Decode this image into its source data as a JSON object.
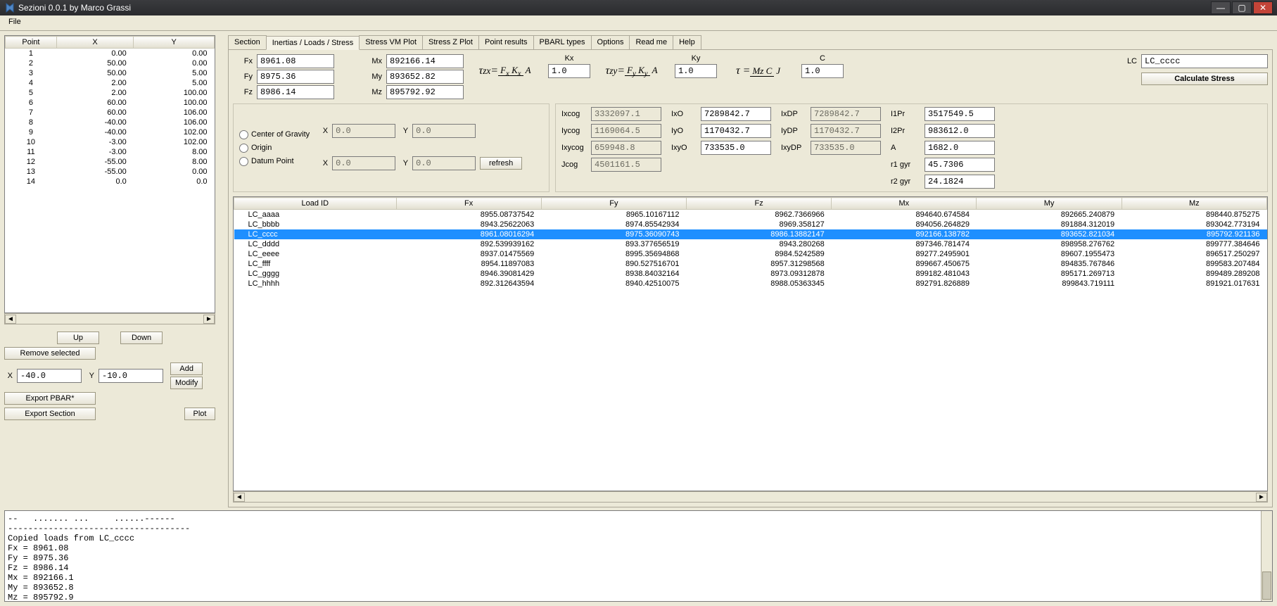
{
  "title": "Sezioni 0.0.1 by Marco Grassi",
  "menubar": {
    "file": "File"
  },
  "points": {
    "headers": [
      "Point",
      "X",
      "Y"
    ],
    "rows": [
      [
        "1",
        "0.00",
        "0.00"
      ],
      [
        "2",
        "50.00",
        "0.00"
      ],
      [
        "3",
        "50.00",
        "5.00"
      ],
      [
        "4",
        "2.00",
        "5.00"
      ],
      [
        "5",
        "2.00",
        "100.00"
      ],
      [
        "6",
        "60.00",
        "100.00"
      ],
      [
        "7",
        "60.00",
        "106.00"
      ],
      [
        "8",
        "-40.00",
        "106.00"
      ],
      [
        "9",
        "-40.00",
        "102.00"
      ],
      [
        "10",
        "-3.00",
        "102.00"
      ],
      [
        "11",
        "-3.00",
        "8.00"
      ],
      [
        "12",
        "-55.00",
        "8.00"
      ],
      [
        "13",
        "-55.00",
        "0.00"
      ],
      [
        "14",
        "0.0",
        "0.0"
      ]
    ]
  },
  "left_buttons": {
    "up": "Up",
    "down": "Down",
    "remove": "Remove selected",
    "add": "Add",
    "modify": "Modify",
    "export_pbar": "Export PBAR*",
    "export_section": "Export Section",
    "plot": "Plot",
    "x_label": "X",
    "x_val": "-40.0",
    "y_label": "Y",
    "y_val": "-10.0"
  },
  "tabs": [
    "Section",
    "Inertias / Loads / Stress",
    "Stress VM Plot",
    "Stress Z Plot",
    "Point results",
    "PBARL types",
    "Options",
    "Read me",
    "Help"
  ],
  "active_tab": 1,
  "forces": {
    "fx_label": "Fx",
    "fx": "8961.08",
    "fy_label": "Fy",
    "fy": "8975.36",
    "fz_label": "Fz",
    "fz": "8986.14",
    "mx_label": "Mx",
    "mx": "892166.14",
    "my_label": "My",
    "my": "893652.82",
    "mz_label": "Mz",
    "mz": "895792.92"
  },
  "kc": {
    "kx_label": "Kx",
    "kx": "1.0",
    "ky_label": "Ky",
    "ky": "1.0",
    "c_label": "C",
    "c": "1.0"
  },
  "lc": {
    "label": "LC",
    "value": "LC_cccc",
    "calc": "Calculate Stress"
  },
  "origin": {
    "cg": "Center of Gravity",
    "origin": "Origin",
    "dp": "Datum Point",
    "x1_label": "X",
    "x1": "0.0",
    "y1_label": "Y",
    "y1": "0.0",
    "x2_label": "X",
    "x2": "0.0",
    "y2_label": "Y",
    "y2": "0.0",
    "refresh": "refresh"
  },
  "cog": {
    "ixcog_label": "Ixcog",
    "ixcog": "3332097.1",
    "iycog_label": "Iycog",
    "iycog": "1169064.5",
    "ixycog_label": "Ixycog",
    "ixycog": "659948.8",
    "jcog_label": "Jcog",
    "jcog": "4501161.5"
  },
  "io": {
    "ixo_label": "IxO",
    "ixo": "7289842.7",
    "iyo_label": "IyO",
    "iyo": "1170432.7",
    "ixyo_label": "IxyO",
    "ixyo": "733535.0"
  },
  "idp": {
    "ixdp_label": "IxDP",
    "ixdp": "7289842.7",
    "iydp_label": "IyDP",
    "iydp": "1170432.7",
    "ixydp_label": "IxyDP",
    "ixydp": "733535.0"
  },
  "props": {
    "i1pr_label": "I1Pr",
    "i1pr": "3517549.5",
    "i2pr_label": "I2Pr",
    "i2pr": "983612.0",
    "a_label": "A",
    "a": "1682.0",
    "r1_label": "r1 gyr",
    "r1": "45.7306",
    "r2_label": "r2 gyr",
    "r2": "24.1824"
  },
  "loads": {
    "headers": [
      "Load ID",
      "Fx",
      "Fy",
      "Fz",
      "Mx",
      "My",
      "Mz"
    ],
    "rows": [
      {
        "sel": false,
        "c": [
          "LC_aaaa",
          "8955.08737542",
          "8965.10167112",
          "8962.7366966",
          "894640.674584",
          "892665.240879",
          "898440.875275"
        ]
      },
      {
        "sel": false,
        "c": [
          "LC_bbbb",
          "8943.25622063",
          "8974.85542934",
          "8969.358127",
          "894056.264829",
          "891884.312019",
          "893042.773194"
        ]
      },
      {
        "sel": true,
        "c": [
          "LC_cccc",
          "8961.08016294",
          "8975.36090743",
          "8986.13882147",
          "892166.138782",
          "893652.821034",
          "895792.921136"
        ]
      },
      {
        "sel": false,
        "c": [
          "LC_dddd",
          "892.539939162",
          "893.377656519",
          "8943.280268",
          "897346.781474",
          "898958.276762",
          "899777.384646"
        ]
      },
      {
        "sel": false,
        "c": [
          "LC_eeee",
          "8937.01475569",
          "8995.35694868",
          "8984.5242589",
          "89277.2495901",
          "89607.1955473",
          "896517.250297"
        ]
      },
      {
        "sel": false,
        "c": [
          "LC_ffff",
          "8954.11897083",
          "890.527516701",
          "8957.31298568",
          "899667.450675",
          "894835.767846",
          "899583.207484"
        ]
      },
      {
        "sel": false,
        "c": [
          "LC_gggg",
          "8946.39081429",
          "8938.84032164",
          "8973.09312878",
          "899182.481043",
          "895171.269713",
          "899489.289208"
        ]
      },
      {
        "sel": false,
        "c": [
          "LC_hhhh",
          "892.312643594",
          "8940.42510075",
          "8988.05363345",
          "892791.826889",
          "899843.719111",
          "891921.017631"
        ]
      }
    ]
  },
  "console_text": "--   ....... ...     ......------\n------------------------------------\nCopied loads from LC_cccc\nFx = 8961.08\nFy = 8975.36\nFz = 8986.14\nMx = 892166.1\nMy = 893652.8\nMz = 895792.9"
}
